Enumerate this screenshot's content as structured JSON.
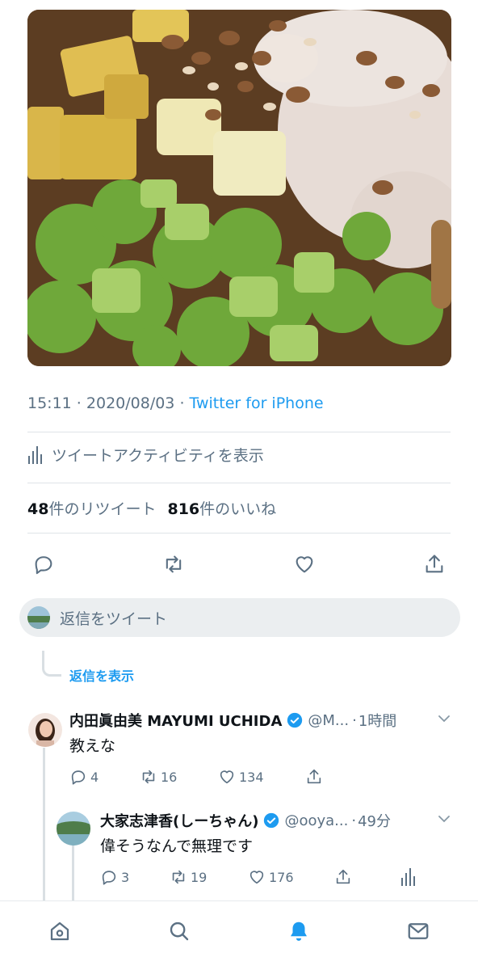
{
  "photo": {
    "alt_icon": "salad-photo"
  },
  "tweet": {
    "time": "15:11",
    "date": "2020/08/03",
    "source": "Twitter for iPhone",
    "activity_label": "ツイートアクティビティを表示",
    "retweet_count": "48",
    "retweet_suffix": "件のリツイート",
    "like_count": "816",
    "like_suffix": "件のいいね"
  },
  "composer": {
    "placeholder": "返信をツイート"
  },
  "show_replies_label": "返信を表示",
  "replies": [
    {
      "name": "内田眞由美 MAYUMI UCHIDA",
      "handle": "@M...",
      "time": "1時間",
      "text": "教えな",
      "reply_count": "4",
      "retweet_count": "16",
      "like_count": "134",
      "verified": true
    },
    {
      "name": "大家志津香(しーちゃん)",
      "handle": "@ooya...",
      "time": "49分",
      "text": "偉そうなんで無理です",
      "reply_count": "3",
      "retweet_count": "19",
      "like_count": "176",
      "verified": true
    }
  ],
  "tabs": [
    "home-icon",
    "search-icon",
    "notifications-icon",
    "messages-icon"
  ],
  "colors": {
    "accent": "#1d9bf0",
    "secondary_text": "#5b7083",
    "divider": "#dfe4e8"
  }
}
